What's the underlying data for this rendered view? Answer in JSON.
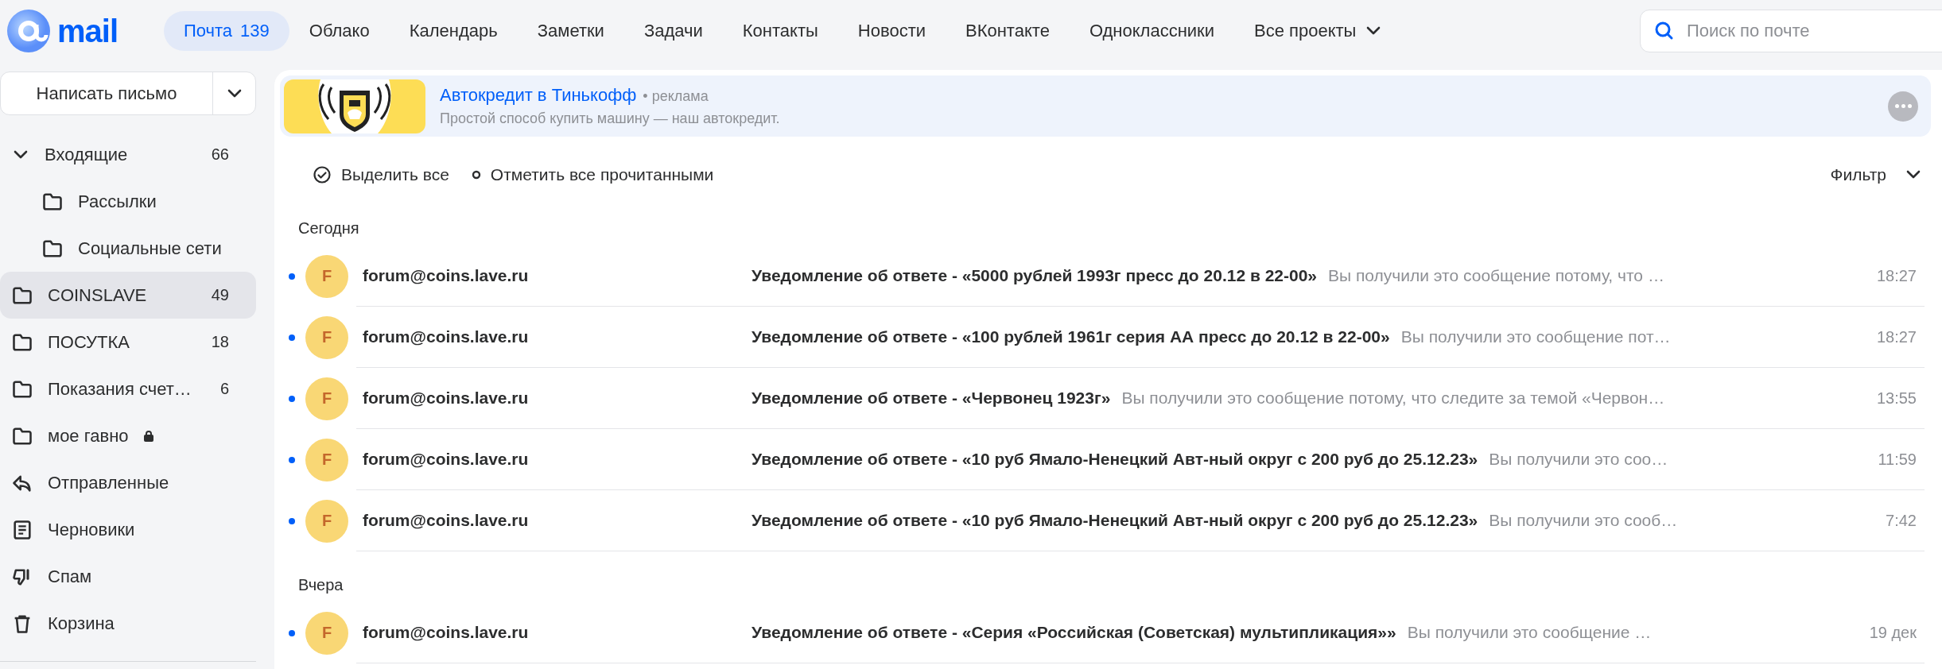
{
  "header": {
    "logo_text": "mail",
    "nav": [
      {
        "label": "Почта",
        "badge": "139",
        "selected": true,
        "kind": "link"
      },
      {
        "label": "Облако",
        "selected": false,
        "kind": "link"
      },
      {
        "label": "Календарь",
        "selected": false,
        "kind": "link"
      },
      {
        "label": "Заметки",
        "selected": false,
        "kind": "link"
      },
      {
        "label": "Задачи",
        "selected": false,
        "kind": "link"
      },
      {
        "label": "Контакты",
        "selected": false,
        "kind": "link"
      },
      {
        "label": "Новости",
        "selected": false,
        "kind": "link"
      },
      {
        "label": "ВКонтакте",
        "selected": false,
        "kind": "link"
      },
      {
        "label": "Одноклассники",
        "selected": false,
        "kind": "link"
      },
      {
        "label": "Все проекты",
        "selected": false,
        "kind": "dropdown"
      }
    ],
    "search": {
      "placeholder": "Поиск по почте"
    }
  },
  "sidebar": {
    "compose": "Написать письмо",
    "folders": [
      {
        "label": "Входящие",
        "count": "66",
        "kind": "inbox",
        "expanded": true,
        "selected": false,
        "locked": false,
        "children": [
          {
            "label": "Рассылки",
            "kind": "folder",
            "selected": false,
            "locked": false
          },
          {
            "label": "Социальные сети",
            "kind": "folder",
            "selected": false,
            "locked": false
          }
        ]
      },
      {
        "label": "COINSLAVE",
        "count": "49",
        "kind": "folder",
        "selected": true,
        "locked": false
      },
      {
        "label": "ПОСУТКА",
        "count": "18",
        "kind": "folder",
        "selected": false,
        "locked": false
      },
      {
        "label": "Показания счет…",
        "count": "6",
        "kind": "folder",
        "selected": false,
        "locked": false
      },
      {
        "label": "мое гавно",
        "kind": "folder",
        "selected": false,
        "locked": true
      },
      {
        "label": "Отправленные",
        "kind": "sent",
        "selected": false,
        "locked": false
      },
      {
        "label": "Черновики",
        "kind": "drafts",
        "selected": false,
        "locked": false
      },
      {
        "label": "Спам",
        "kind": "spam",
        "selected": false,
        "locked": false
      },
      {
        "label": "Корзина",
        "kind": "trash",
        "selected": false,
        "locked": false
      }
    ]
  },
  "ad": {
    "title": "Автокредит в Тинькофф",
    "tag": "• реклама",
    "text": "Простой способ купить машину — наш автокредит."
  },
  "toolbar": {
    "select_all": "Выделить все",
    "mark_read": "Отметить все прочитанными",
    "filter": "Фильтр"
  },
  "groups": [
    {
      "label": "Сегодня",
      "messages": [
        {
          "sender": "forum@coins.lave.ru",
          "avatar": "F",
          "unread": true,
          "subject": "Уведомление об ответе - «5000 рублей 1993г пресс до 20.12 в 22-00»",
          "snippet": "Вы получили это сообщение потому, что …",
          "time": "18:27"
        },
        {
          "sender": "forum@coins.lave.ru",
          "avatar": "F",
          "unread": true,
          "subject": "Уведомление об ответе - «100 рублей 1961г серия АА пресс до 20.12 в 22-00»",
          "snippet": "Вы получили это сообщение пот…",
          "time": "18:27"
        },
        {
          "sender": "forum@coins.lave.ru",
          "avatar": "F",
          "unread": true,
          "subject": "Уведомление об ответе - «Червонец 1923г»",
          "snippet": "Вы получили это сообщение потому, что следите за темой «Червон…",
          "time": "13:55"
        },
        {
          "sender": "forum@coins.lave.ru",
          "avatar": "F",
          "unread": true,
          "subject": "Уведомление об ответе - «10 руб Ямало-Ненецкий Авт-ный округ с 200 руб до 25.12.23»",
          "snippet": "Вы получили это соо…",
          "time": "11:59"
        },
        {
          "sender": "forum@coins.lave.ru",
          "avatar": "F",
          "unread": true,
          "subject": "Уведомление об ответе - «10 руб Ямало-Ненецкий Авт-ный округ с 200 руб до 25.12.23»",
          "snippet": "Вы получили это сооб…",
          "time": "7:42"
        }
      ]
    },
    {
      "label": "Вчера",
      "messages": [
        {
          "sender": "forum@coins.lave.ru",
          "avatar": "F",
          "unread": true,
          "subject": "Уведомление об ответе - «Серия «Российская (Советская) мультипликация»»",
          "snippet": "Вы получили это сообщение …",
          "time": "19 дек"
        }
      ]
    }
  ]
}
